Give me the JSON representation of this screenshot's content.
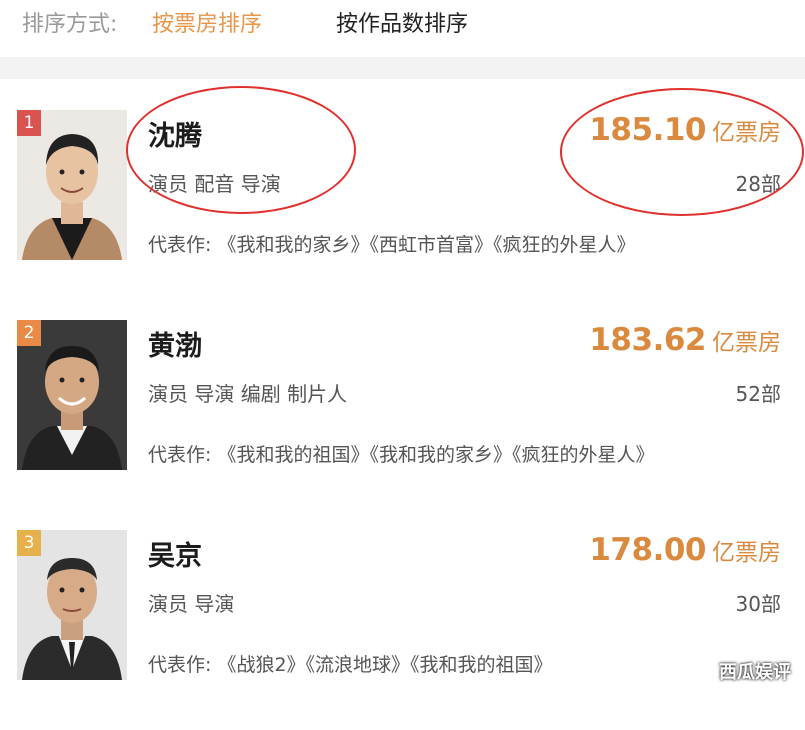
{
  "sort": {
    "label": "排序方式:",
    "active_option": "按票房排序",
    "other_option": "按作品数排序"
  },
  "people": [
    {
      "rank": "1",
      "rank_color": "#d9534f",
      "name": "沈腾",
      "roles": "演员 配音 导演",
      "box_office": "185.10",
      "box_unit": "亿票房",
      "works_count": "28部",
      "works_label": "代表作:",
      "works": "《我和我的家乡》《西虹市首富》《疯狂的外星人》"
    },
    {
      "rank": "2",
      "rank_color": "#e98b47",
      "name": "黄渤",
      "roles": "演员 导演 编剧 制片人",
      "box_office": "183.62",
      "box_unit": "亿票房",
      "works_count": "52部",
      "works_label": "代表作:",
      "works": "《我和我的祖国》《我和我的家乡》《疯狂的外星人》"
    },
    {
      "rank": "3",
      "rank_color": "#e6b04b",
      "name": "吴京",
      "roles": "演员 导演",
      "box_office": "178.00",
      "box_unit": "亿票房",
      "works_count": "30部",
      "works_label": "代表作:",
      "works": "《战狼2》《流浪地球》《我和我的祖国》"
    }
  ],
  "watermark": "西瓜娱评",
  "colors": {
    "accent": "#d98a3f",
    "annotation": "#e0302d"
  }
}
